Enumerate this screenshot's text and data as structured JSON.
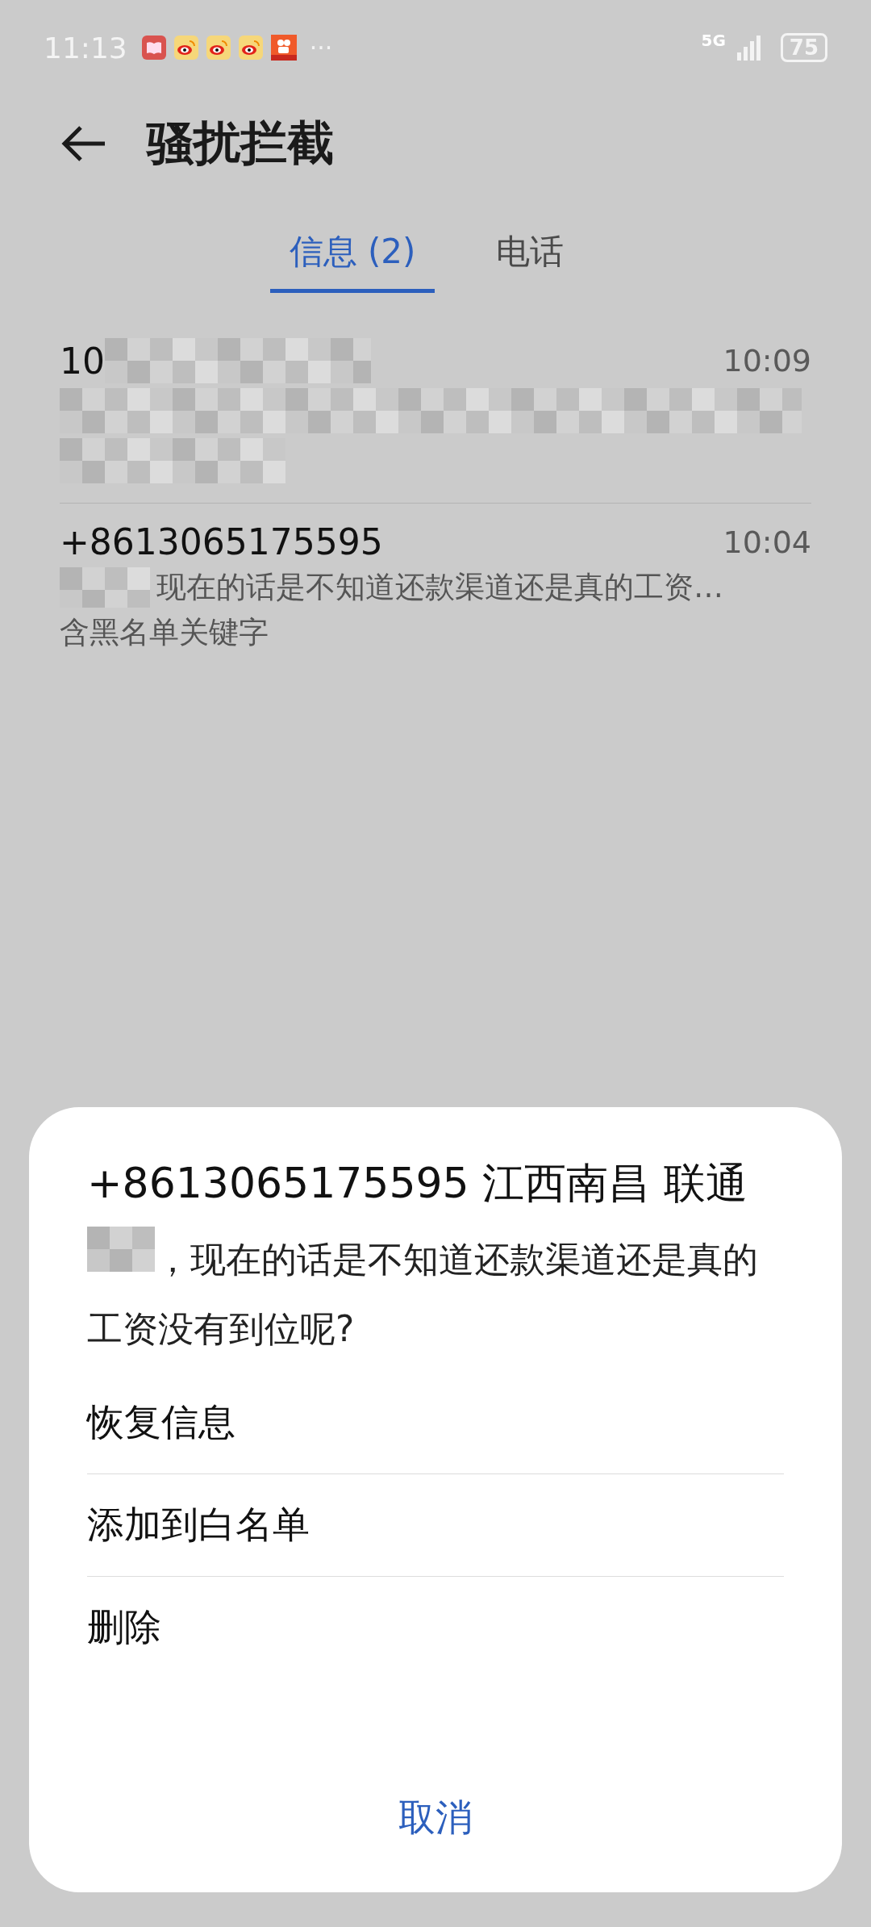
{
  "status_bar": {
    "time": "11:13",
    "more": "···",
    "network": "5G",
    "battery": "75"
  },
  "header": {
    "title": "骚扰拦截"
  },
  "tabs": [
    {
      "label": "信息 (2)",
      "selected": true
    },
    {
      "label": "电话",
      "selected": false
    }
  ],
  "messages": [
    {
      "sender": "10",
      "sender_redacted": true,
      "time": "10:09",
      "preview_redacted": true
    },
    {
      "sender": "+8613065175595",
      "sender_redacted": false,
      "time": "10:04",
      "preview": "现在的话是不知道还款渠道还是真的工资…",
      "preview_redacted": false,
      "prefix_redacted": true,
      "note": "含黑名单关键字"
    }
  ],
  "dialog": {
    "title": "+8613065175595 江西南昌 联通",
    "body": "，现在的话是不知道还款渠道还是真的工资没有到位呢?",
    "body_prefix_redacted": true,
    "actions": [
      "恢复信息",
      "添加到白名单",
      "删除"
    ],
    "cancel": "取消"
  }
}
